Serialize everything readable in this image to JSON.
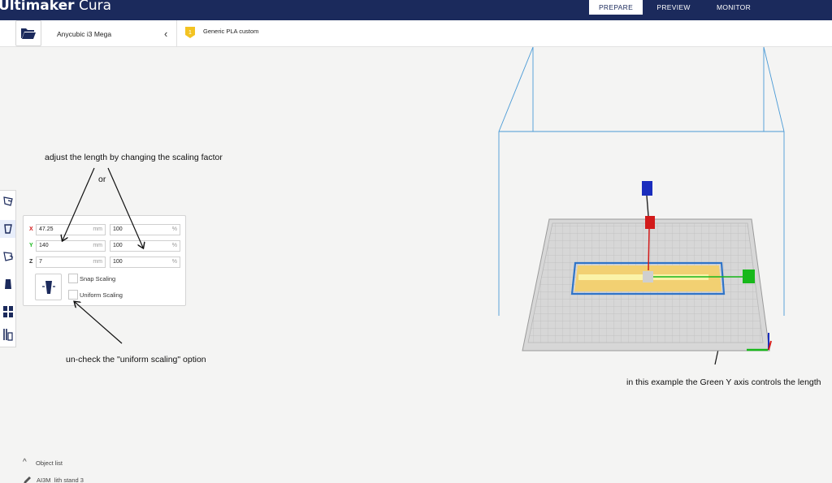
{
  "app": {
    "brand_bold": "Ultimaker",
    "brand_light": " Cura",
    "tabs": [
      {
        "label": "PREPARE",
        "active": true
      },
      {
        "label": "PREVIEW",
        "active": false
      },
      {
        "label": "MONITOR",
        "active": false
      }
    ]
  },
  "header": {
    "printer_name": "Anycubic i3 Mega",
    "material_badge": "1",
    "material_name": "Generic PLA custom"
  },
  "scale_panel": {
    "rows": [
      {
        "axis": "X",
        "size": "47.25",
        "size_unit": "mm",
        "percent": "100",
        "percent_unit": "%"
      },
      {
        "axis": "Y",
        "size": "140",
        "size_unit": "mm",
        "percent": "100",
        "percent_unit": "%"
      },
      {
        "axis": "Z",
        "size": "7",
        "size_unit": "mm",
        "percent": "100",
        "percent_unit": "%"
      }
    ],
    "snap_scaling_label": "Snap Scaling",
    "uniform_scaling_label": "Uniform Scaling",
    "snap_scaling_checked": false,
    "uniform_scaling_checked": false
  },
  "annotations": {
    "adjust": "adjust the length by changing the scaling factor",
    "or": "or",
    "uncheck": "un-check the \"uniform scaling\" option",
    "example": "in this example the Green Y axis controls the length"
  },
  "object_list": {
    "label": "Object list",
    "object_name": "AI3M_lith stand 3"
  },
  "colors": {
    "topbar": "#1b2a5c",
    "axis_x": "#d21a1a",
    "axis_y": "#17b81a",
    "axis_z": "#1a2dbd",
    "model_fill": "#f2d072",
    "model_outline": "#2f74c8"
  }
}
